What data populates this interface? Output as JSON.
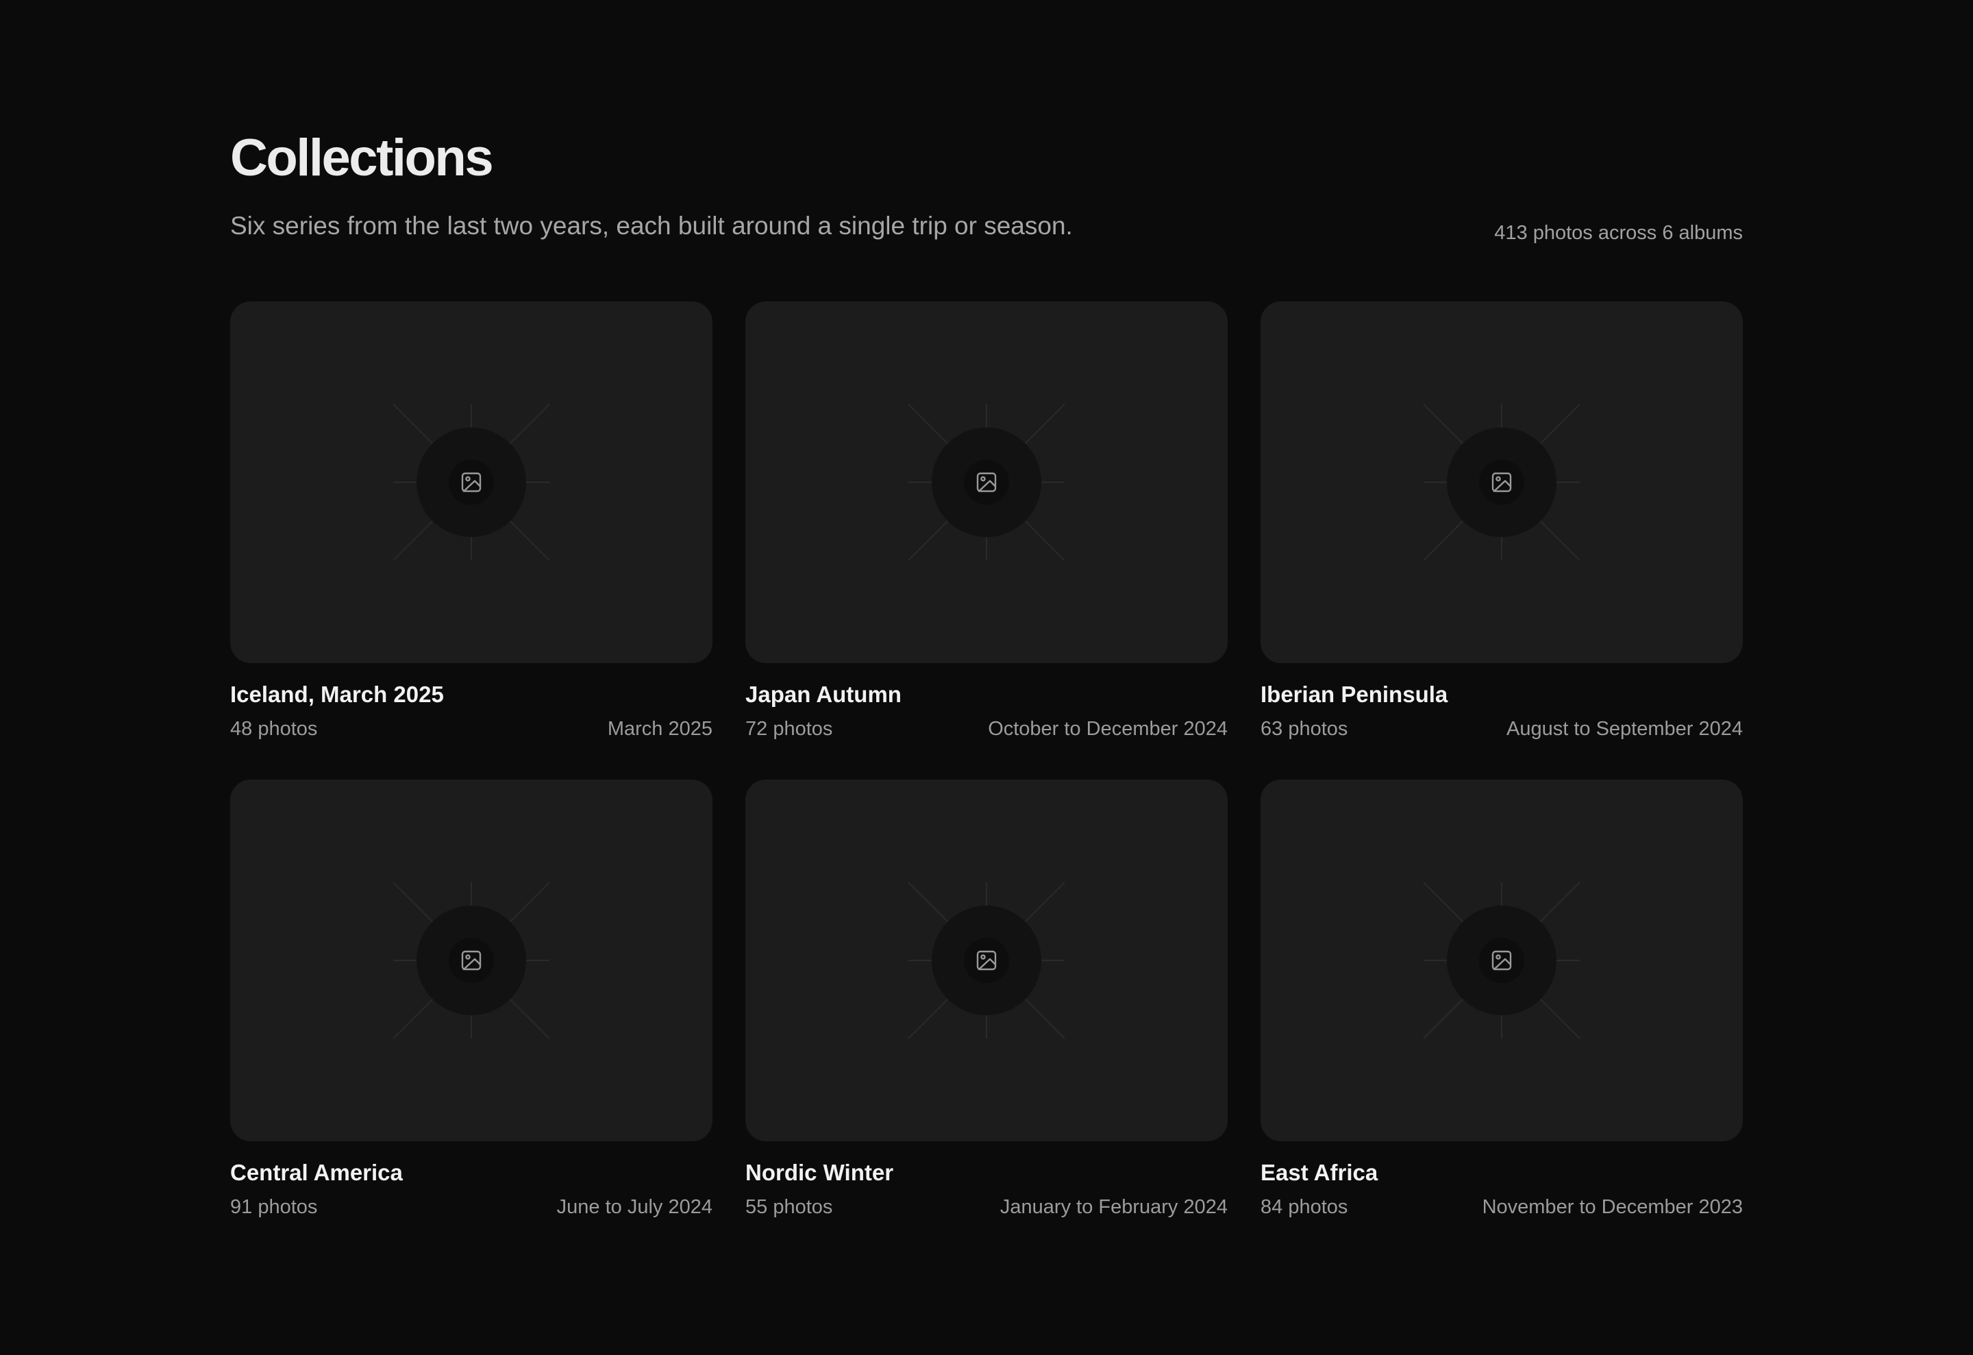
{
  "header": {
    "title": "Collections",
    "subtitle": "Six series from the last two years, each built around a single trip or season.",
    "summary": "413 photos across 6 albums"
  },
  "collections": [
    {
      "title": "Iceland, March 2025",
      "count": "48 photos",
      "date": "March 2025",
      "icon": "image-icon"
    },
    {
      "title": "Japan Autumn",
      "count": "72 photos",
      "date": "October to December 2024",
      "icon": "image-icon"
    },
    {
      "title": "Iberian Peninsula",
      "count": "63 photos",
      "date": "August to September 2024",
      "icon": "image-icon"
    },
    {
      "title": "Central America",
      "count": "91 photos",
      "date": "June to July 2024",
      "icon": "image-icon"
    },
    {
      "title": "Nordic Winter",
      "count": "55 photos",
      "date": "January to February 2024",
      "icon": "image-icon"
    },
    {
      "title": "East Africa",
      "count": "84 photos",
      "date": "November to December 2023",
      "icon": "image-icon"
    }
  ],
  "colors": {
    "background": "#0b0b0b",
    "card": "#1c1c1c",
    "text": "#ececec",
    "muted": "#a2a2a2"
  }
}
